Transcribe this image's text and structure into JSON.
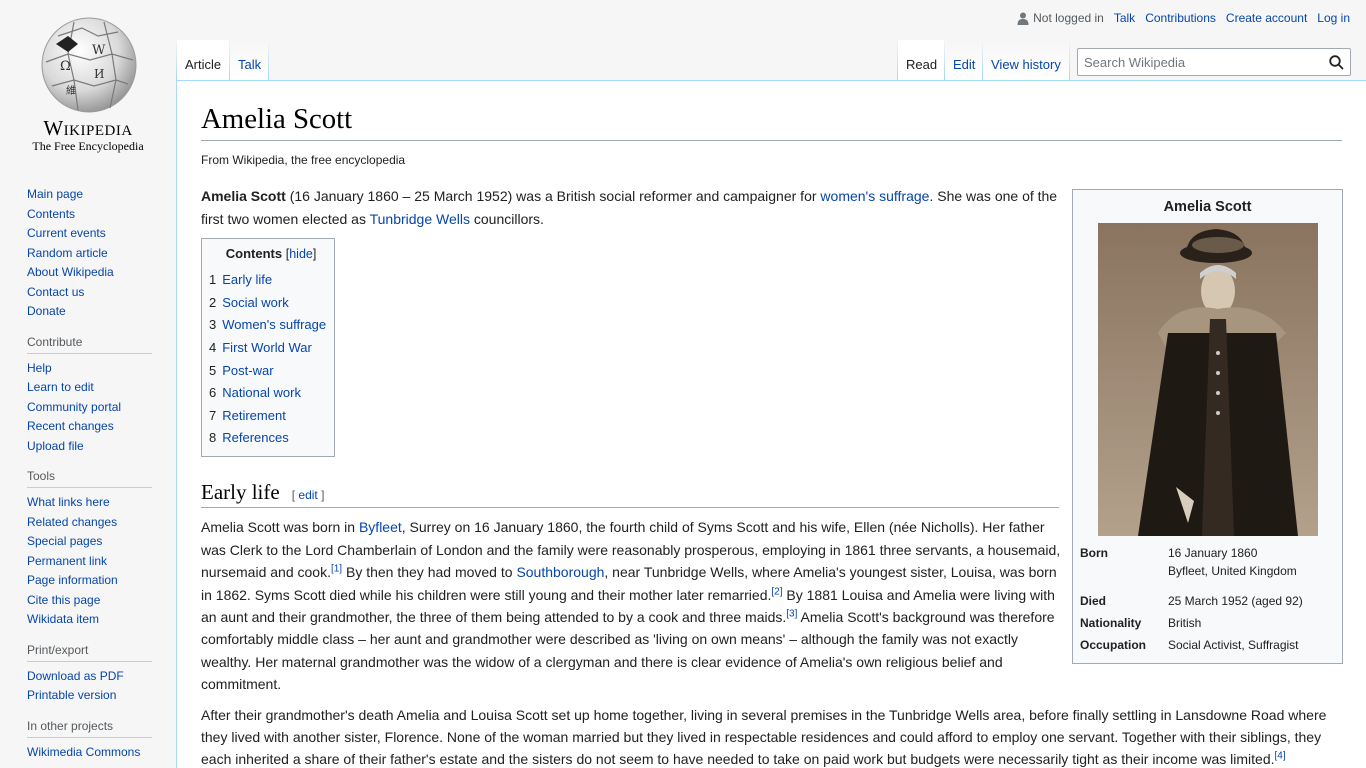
{
  "logo": {
    "wordmark": "Wikipedia",
    "tagline": "The Free Encyclopedia"
  },
  "personal": {
    "not_logged_in": "Not logged in",
    "links": [
      "Talk",
      "Contributions",
      "Create account",
      "Log in"
    ]
  },
  "tabs": {
    "left": [
      "Article",
      "Talk"
    ],
    "right": [
      "Read",
      "Edit",
      "View history"
    ]
  },
  "search": {
    "placeholder": "Search Wikipedia"
  },
  "sidebar": {
    "navigation": [
      "Main page",
      "Contents",
      "Current events",
      "Random article",
      "About Wikipedia",
      "Contact us",
      "Donate"
    ],
    "contribute": {
      "heading": "Contribute",
      "items": [
        "Help",
        "Learn to edit",
        "Community portal",
        "Recent changes",
        "Upload file"
      ]
    },
    "tools": {
      "heading": "Tools",
      "items": [
        "What links here",
        "Related changes",
        "Special pages",
        "Permanent link",
        "Page information",
        "Cite this page",
        "Wikidata item"
      ]
    },
    "print": {
      "heading": "Print/export",
      "items": [
        "Download as PDF",
        "Printable version"
      ]
    },
    "projects": {
      "heading": "In other projects",
      "items": [
        "Wikimedia Commons"
      ]
    }
  },
  "article": {
    "title": "Amelia Scott",
    "site_sub": "From Wikipedia, the free encyclopedia",
    "lead": {
      "bold": "Amelia Scott",
      "t1": " (16 January 1860 – 25 March 1952) was a British social reformer and campaigner for ",
      "link1": "women's suffrage",
      "t2": ". She was one of the first two women elected as ",
      "link2": "Tunbridge Wells",
      "t3": " councillors."
    },
    "toc": {
      "title": "Contents",
      "toggle": "hide",
      "items": [
        {
          "num": "1",
          "label": "Early life"
        },
        {
          "num": "2",
          "label": "Social work"
        },
        {
          "num": "3",
          "label": "Women's suffrage"
        },
        {
          "num": "4",
          "label": "First World War"
        },
        {
          "num": "5",
          "label": "Post-war"
        },
        {
          "num": "6",
          "label": "National work"
        },
        {
          "num": "7",
          "label": "Retirement"
        },
        {
          "num": "8",
          "label": "References"
        }
      ]
    },
    "section1": {
      "heading": "Early life",
      "edit": "edit",
      "p1": {
        "a": "Amelia Scott was born in ",
        "link_byfleet": "Byfleet",
        "b": ", Surrey on 16 January 1860, the fourth child of Syms Scott and his wife, Ellen (née Nicholls). Her father was Clerk to the Lord Chamberlain of London and the family were reasonably prosperous, employing in 1861 three servants, a housemaid, nursemaid and cook.",
        "ref1": "[1]",
        "c": " By then they had moved to ",
        "link_south": "Southborough",
        "d": ", near Tunbridge Wells, where Amelia's youngest sister, Louisa, was born in 1862. Syms Scott died while his children were still young and their mother later remarried.",
        "ref2": "[2]",
        "e": " By 1881 Louisa and Amelia were living with an aunt and their grandmother, the three of them being attended to by a cook and three maids.",
        "ref3": "[3]",
        "f": " Amelia Scott's background was therefore comfortably middle class – her aunt and grandmother were described as 'living on own means' – although the family was not exactly wealthy. Her maternal grandmother was the widow of a clergyman and there is clear evidence of Amelia's own religious belief and commitment."
      },
      "p2": {
        "a": "After their grandmother's death Amelia and Louisa Scott set up home together, living in several premises in the Tunbridge Wells area, before finally settling in Lansdowne Road where they lived with another sister, Florence. None of the woman married but they lived in respectable residences and could afford to employ one servant. Together with their siblings, they each inherited a share of their father's estate and the sisters do not seem to have needed to take on paid work but budgets were necessarily tight as their income was limited.",
        "ref4": "[4]"
      }
    },
    "infobox": {
      "title": "Amelia Scott",
      "rows": [
        {
          "label": "Born",
          "value": "16 January 1860",
          "value2": "Byfleet, United Kingdom"
        },
        {
          "label": "Died",
          "value": "25 March 1952 (aged 92)"
        },
        {
          "label": "Nationality",
          "value": "British"
        },
        {
          "label": "Occupation",
          "value": "Social Activist, Suffragist"
        }
      ]
    }
  }
}
